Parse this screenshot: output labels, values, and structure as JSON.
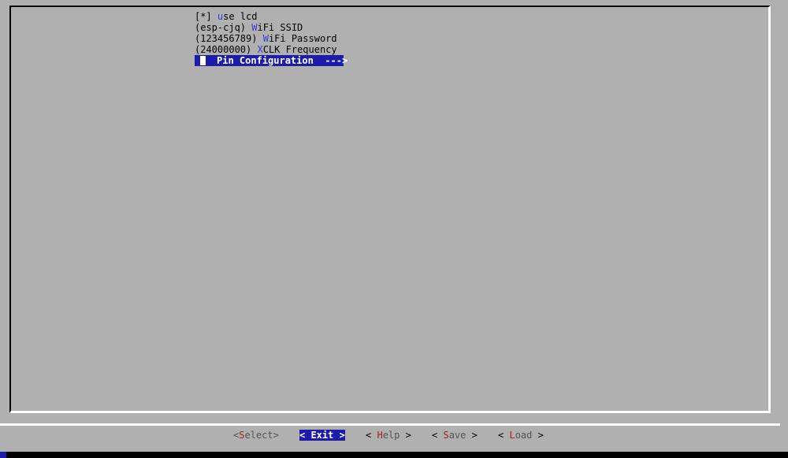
{
  "menu": {
    "items": [
      {
        "prefix": "[*] ",
        "hotkey": "u",
        "rest": "se lcd"
      },
      {
        "prefix": "(esp-cjq) ",
        "hotkey": "W",
        "rest": "iFi SSID"
      },
      {
        "prefix": "(123456789) ",
        "hotkey": "W",
        "rest": "iFi Password"
      },
      {
        "prefix": "(24000000) ",
        "hotkey": "X",
        "rest": "CLK Frequency"
      },
      {
        "label": "Pin Configuration  --->"
      }
    ]
  },
  "buttons": {
    "select": {
      "open": "<",
      "hotkey": "S",
      "rest": "elect",
      "close": ">"
    },
    "exit": {
      "text": "< Exit >"
    },
    "help": {
      "open": "< ",
      "hotkey": "H",
      "rest": "elp",
      "close": " >"
    },
    "save": {
      "open": "< ",
      "hotkey": "S",
      "rest": "ave",
      "close": " >"
    },
    "load": {
      "open": "< ",
      "hotkey": "L",
      "rest": "oad",
      "close": " >"
    }
  },
  "colors": {
    "background": "#b0b0b0",
    "highlight": "#1c1ca8",
    "hotkey_menu": "#3a3ae0",
    "hotkey_button": "#a52020"
  }
}
